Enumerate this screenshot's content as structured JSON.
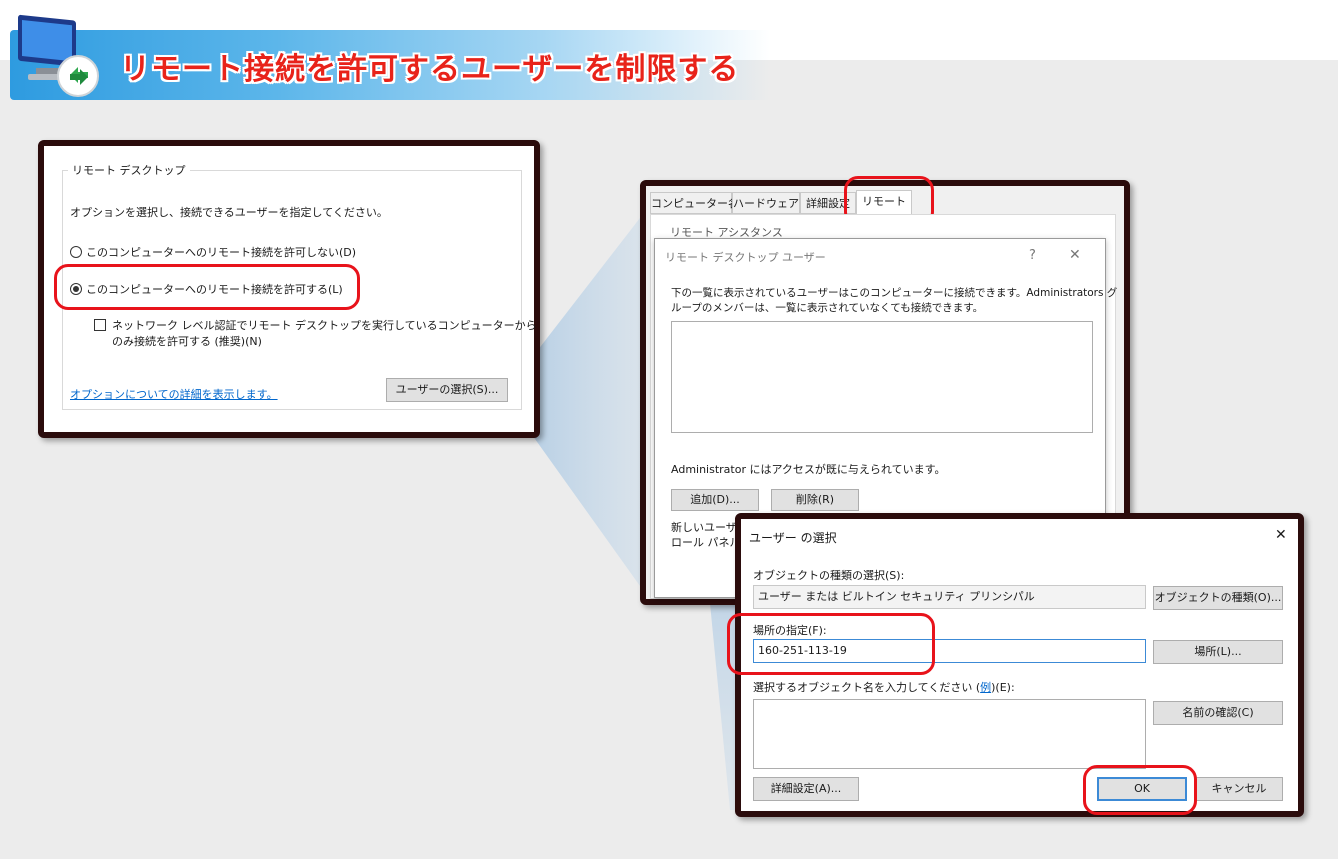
{
  "page_title": "リモート接続を許可するユーザーを制限する",
  "colors": {
    "highlight": "#e8131b",
    "title": "#e8231a",
    "frame": "#2b0c0c",
    "link": "#0066cc",
    "banner": "#2e9be0"
  },
  "system_panel": {
    "group_title": "リモート デスクトップ",
    "instruction": "オプションを選択し、接続できるユーザーを指定してください。",
    "radio_deny": "このコンピューターへのリモート接続を許可しない(D)",
    "radio_allow": "このコンピューターへのリモート接続を許可する(L)",
    "nla_line1": "ネットワーク レベル認証でリモート デスクトップを実行しているコンピューターから",
    "nla_line2": "のみ接続を許可する (推奨)(N)",
    "details_link": "オプションについての詳細を表示します。",
    "select_users_button": "ユーザーの選択(S)..."
  },
  "properties_panel": {
    "tabs": [
      "コンピューター名",
      "ハードウェア",
      "詳細設定",
      "リモート"
    ],
    "remote_assist_label": "リモート アシスタンス",
    "rdu_dialog": {
      "title": "リモート デスクトップ ユーザー",
      "help": "?",
      "close": "✕",
      "desc_line1": "下の一覧に表示されているユーザーはこのコンピューターに接続できます。Administrators グ",
      "desc_line2": "ループのメンバーは、一覧に表示されていなくても接続できます。",
      "access_note": "Administrator にはアクセスが既に与えられています。",
      "add_button": "追加(D)...",
      "remove_button": "削除(R)",
      "new_user_line1": "新しいユーザー",
      "new_user_line2": "ロール パネル"
    }
  },
  "select_users_dialog": {
    "title": "ユーザー の選択",
    "close": "✕",
    "object_type_label": "オブジェクトの種類の選択(S):",
    "object_type_value": "ユーザー または ビルトイン セキュリティ プリンシパル",
    "object_type_button": "オブジェクトの種類(O)...",
    "location_label": "場所の指定(F):",
    "location_value": "160-251-113-19",
    "location_button": "場所(L)...",
    "names_label": "選択するオブジェクト名を入力してください (",
    "names_example": "例",
    "names_label_end": ")(E):",
    "check_names_button": "名前の確認(C)",
    "advanced_button": "詳細設定(A)...",
    "ok_button": "OK",
    "cancel_button": "キャンセル"
  }
}
